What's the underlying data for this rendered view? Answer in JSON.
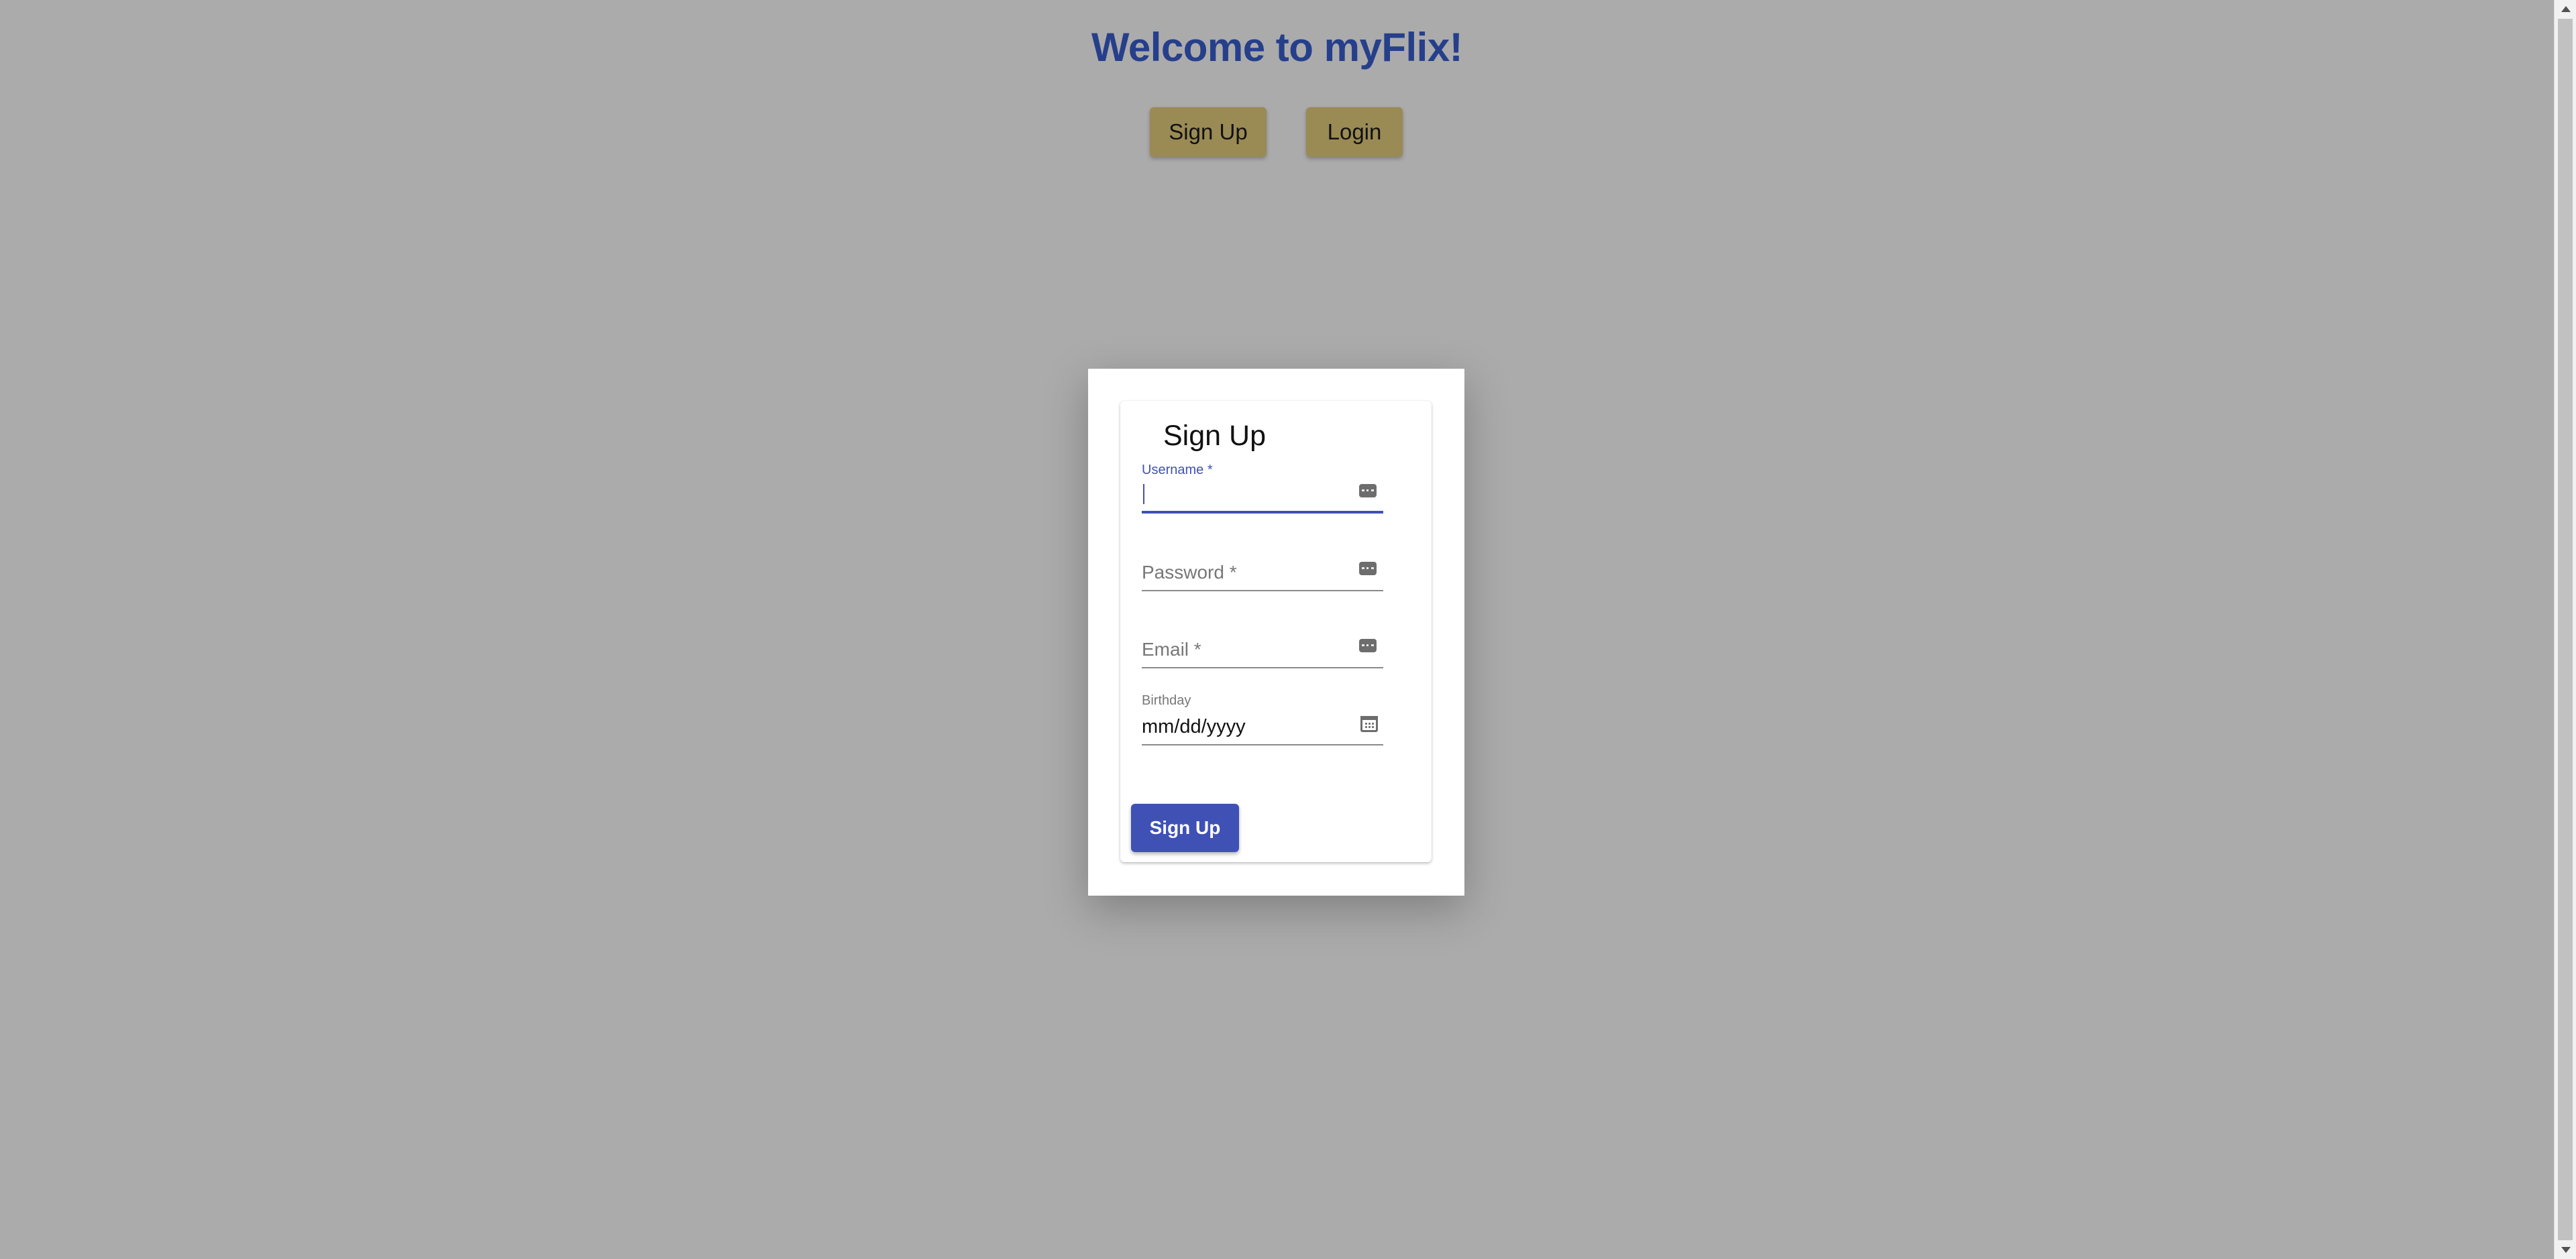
{
  "header": {
    "title": "Welcome to myFlix!",
    "signup_label": "Sign Up",
    "login_label": "Login"
  },
  "signup_form": {
    "title": "Sign Up",
    "username_label": "Username *",
    "password_label": "Password *",
    "email_label": "Email *",
    "birthday_label": "Birthday",
    "birthday_placeholder": "mm/dd/yyyy",
    "submit_label": "Sign Up"
  },
  "colors": {
    "title": "#263f8b",
    "top_buttons": "#9a8a54",
    "primary": "#3f51b5",
    "backdrop": "#ababab"
  },
  "icons": {
    "field_icon": "password-manager-icon",
    "birthday_icon": "calendar-icon"
  }
}
